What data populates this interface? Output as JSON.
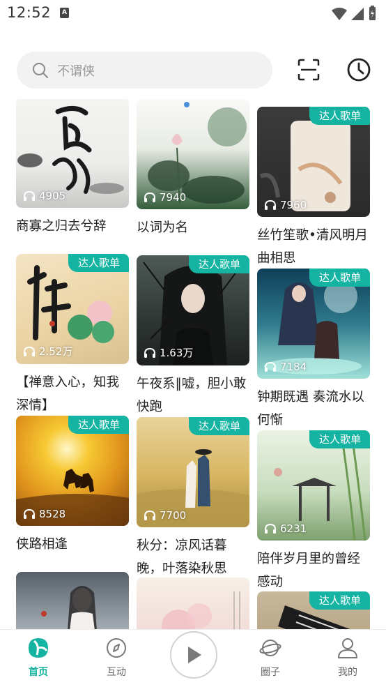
{
  "status_bar": {
    "time": "12:52",
    "sim_label": "A"
  },
  "search": {
    "placeholder": "不谓侠"
  },
  "feed": {
    "badge_text": "达人歌单",
    "cards": [
      {
        "title": "商寡之归去兮辞",
        "plays": "4905",
        "badge": false
      },
      {
        "title": "以词为名",
        "plays": "7940",
        "badge": false
      },
      {
        "title": "丝竹笙歌•清风明月曲相思",
        "plays": "7960",
        "badge": true
      },
      {
        "title": "【禅意入心，知我深情】",
        "plays": "2.52万",
        "badge": true
      },
      {
        "title": "午夜系‖嘘，胆小敢快跑",
        "plays": "1.63万",
        "badge": true
      },
      {
        "title": "钟期既遇 奏流水以何惭",
        "plays": "7184",
        "badge": true
      },
      {
        "title": "侠路相逢",
        "plays": "8528",
        "badge": true
      },
      {
        "title": "秋分：凉风话暮晚，叶落染秋思",
        "plays": "7700",
        "badge": true
      },
      {
        "title": "陪伴岁月里的曾经感动",
        "plays": "6231",
        "badge": true
      },
      {
        "title": "",
        "plays": "",
        "badge": false
      },
      {
        "title": "",
        "plays": "",
        "badge": false
      },
      {
        "title": "",
        "plays": "",
        "badge": true
      }
    ]
  },
  "tabs": [
    {
      "label": "首页",
      "icon": "home-icon",
      "active": true
    },
    {
      "label": "互动",
      "icon": "compass-icon",
      "active": false
    },
    {
      "label": "圈子",
      "icon": "planet-icon",
      "active": false
    },
    {
      "label": "我的",
      "icon": "user-icon",
      "active": false
    }
  ],
  "colors": {
    "accent": "#14b3a2"
  }
}
